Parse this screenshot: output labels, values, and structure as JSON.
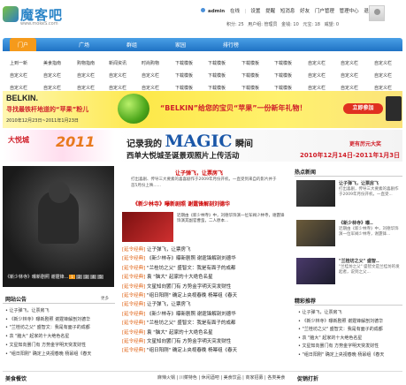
{
  "logo": {
    "name": "魔客吧",
    "url_text": "www.mokeS.com"
  },
  "userbar": {
    "username": "admin",
    "online": "在线",
    "links": [
      "设置",
      "提醒",
      "短消息",
      "好友",
      "门户管理",
      "管理中心",
      "退出"
    ],
    "stats": [
      "积分: 25",
      "用户组: 管理员",
      "金钱: 10",
      "元宝: 18",
      "威望: 0",
      "用户组: 管理员"
    ]
  },
  "nav": {
    "items": [
      "门户",
      "广场",
      "群组",
      "家园",
      "排行榜"
    ]
  },
  "subnav": {
    "row1": [
      "上到一新",
      "美食指南",
      "购物指南",
      "新闻资讯",
      "时尚购物",
      "下载模板",
      "下载模板",
      "下载模板",
      "下载模板",
      "自定义栏",
      "自定义栏",
      "自定义栏"
    ],
    "row2": [
      "自定义栏",
      "自定义栏",
      "自定义栏",
      "自定义栏",
      "自定义栏",
      "下载模板",
      "下载模板",
      "下载模板",
      "下载模板",
      "自定义栏",
      "自定义栏",
      "自定义栏"
    ],
    "row3": [
      "自定义栏",
      "自定义栏",
      "自定义栏",
      "自定义栏",
      "自定义栏",
      "下载模板",
      "下载模板",
      "下载模板",
      "下载模板",
      "自定义栏",
      "自定义栏",
      "自定义栏"
    ]
  },
  "banner1": {
    "brand": "BELKIN.",
    "slogan": "寻找最铁杆地道的“苹果”粉儿",
    "date": "2010年12月23日~2011年1月23日",
    "quote": "“BELKIN”给您的宝贝“苹果”一份新年礼物！",
    "button": "立即参加"
  },
  "banner2": {
    "logo": "大悦城",
    "year": "2011",
    "title_pre": "记录我的",
    "title_magic": "MAGIC",
    "title_post": "瞬间",
    "subtitle": "西单大悦城圣诞景观照片上传活动",
    "date": "2010年12月14日-2011年1月3日",
    "more": "更有厉元大奖"
  },
  "feature": {
    "caption": "《新少林寺》曝新剧照 谢霆锋…",
    "dots": [
      "1",
      "2",
      "3",
      "4",
      "5"
    ]
  },
  "notice": {
    "title": "网站公告",
    "more": "更多",
    "items": [
      "• 让子弹飞，让票房飞",
      "• 《新少林寺》曝新剧照 谢霆锋解剖刘德华",
      "• \"兰桂坊之父\" 盛智文：我是有面子的成都",
      "• 袁 \"脑大\" 起家的十大绝色名星",
      "• 文星知向罢门有 方势金字明天突发财性",
      "• \"组日阳刚\" 确定上央视春晚 杨幂组《春天"
    ]
  },
  "headline": {
    "title": "让子弹飞，让票房飞",
    "text": "打出喜剧、传导三大要素的喜喜剧作于2009年月份开机，一直受到来自的影片并于首5月份上映......",
    "title2": "《新少林寺》曝新剧照 谢霆锋解剖刘德华",
    "poster_text": "近期由《新少林寺》中，刘德华饰演一位军阀少林寺，谢霆锋饰演其副官曹蛮，二人原本..."
  },
  "news": {
    "tag": "[延令经典]",
    "items": [
      "让子弹飞，让票房飞",
      "《新少林寺》曝新剧照 谢霆锋解剖刘德华",
      "\"兰桂坊之父\" 盛智文：我是有面子的成都",
      "袁 \"脑大\" 起家的十大绝色名星",
      "文星知向罢门有 方势金字明天突发财性",
      "\"组日阳刚\" 确定上央视春晚 杨幂组《春天",
      "让子弹飞，让票房飞",
      "《新少林寺》曝新剧照 谢霆锋解剖刘德华",
      "\"兰桂坊之父\" 盛智文：我是有面子的成都",
      "袁 \"脑大\" 起家的十大绝色名星",
      "文星知向罢门有 方势金字明天突发财性",
      "\"组日阳刚\" 确定上央视春晚 杨幂组《春天"
    ]
  },
  "hot": {
    "title": "热点新闻",
    "items": [
      {
        "title": "让子弹飞，让票房飞",
        "desc": "打出喜剧，传导三大要素的喜剧作于2009年月份开机，一直受..."
      },
      {
        "title": "《新少林寺》曝..",
        "desc": "近期由《新少林寺》中，刘德华饰演一位军阀少林寺，谢霆锋..."
      },
      {
        "title": "\"兰桂坊之父\" 盛智..",
        "desc": "\"兰桂坊之父\" 盛智文是兰桂坊的发起者，说到之父..."
      }
    ]
  },
  "recommend": {
    "title": "精彩推荐",
    "items": [
      "• 让子弹飞，让票房飞",
      "• 《新少林寺》曝新剧照 谢霆锋解剖刘德华",
      "• \"兰桂坊之父\" 盛智文：我是有面子的成都",
      "• 袁 \"脑大\" 起家的十大绝色名星",
      "• 文星知向罢门有 方势金字明天突发财性",
      "• \"组日阳刚\" 确定上央视春晚 杨幂组《春天"
    ]
  },
  "bottom": {
    "left": "美食餐饮",
    "links": "麻辣火锅 | 川菜特色 | 休闲酒吧 | 美食饮品 | 商家招募 | 各类美食",
    "right": "促销打折"
  },
  "colors": {
    "nav_blue": "#1f72c4",
    "nav_active": "#f59a1b",
    "headline_red": "#cc0000",
    "tag_orange": "#e06010"
  }
}
